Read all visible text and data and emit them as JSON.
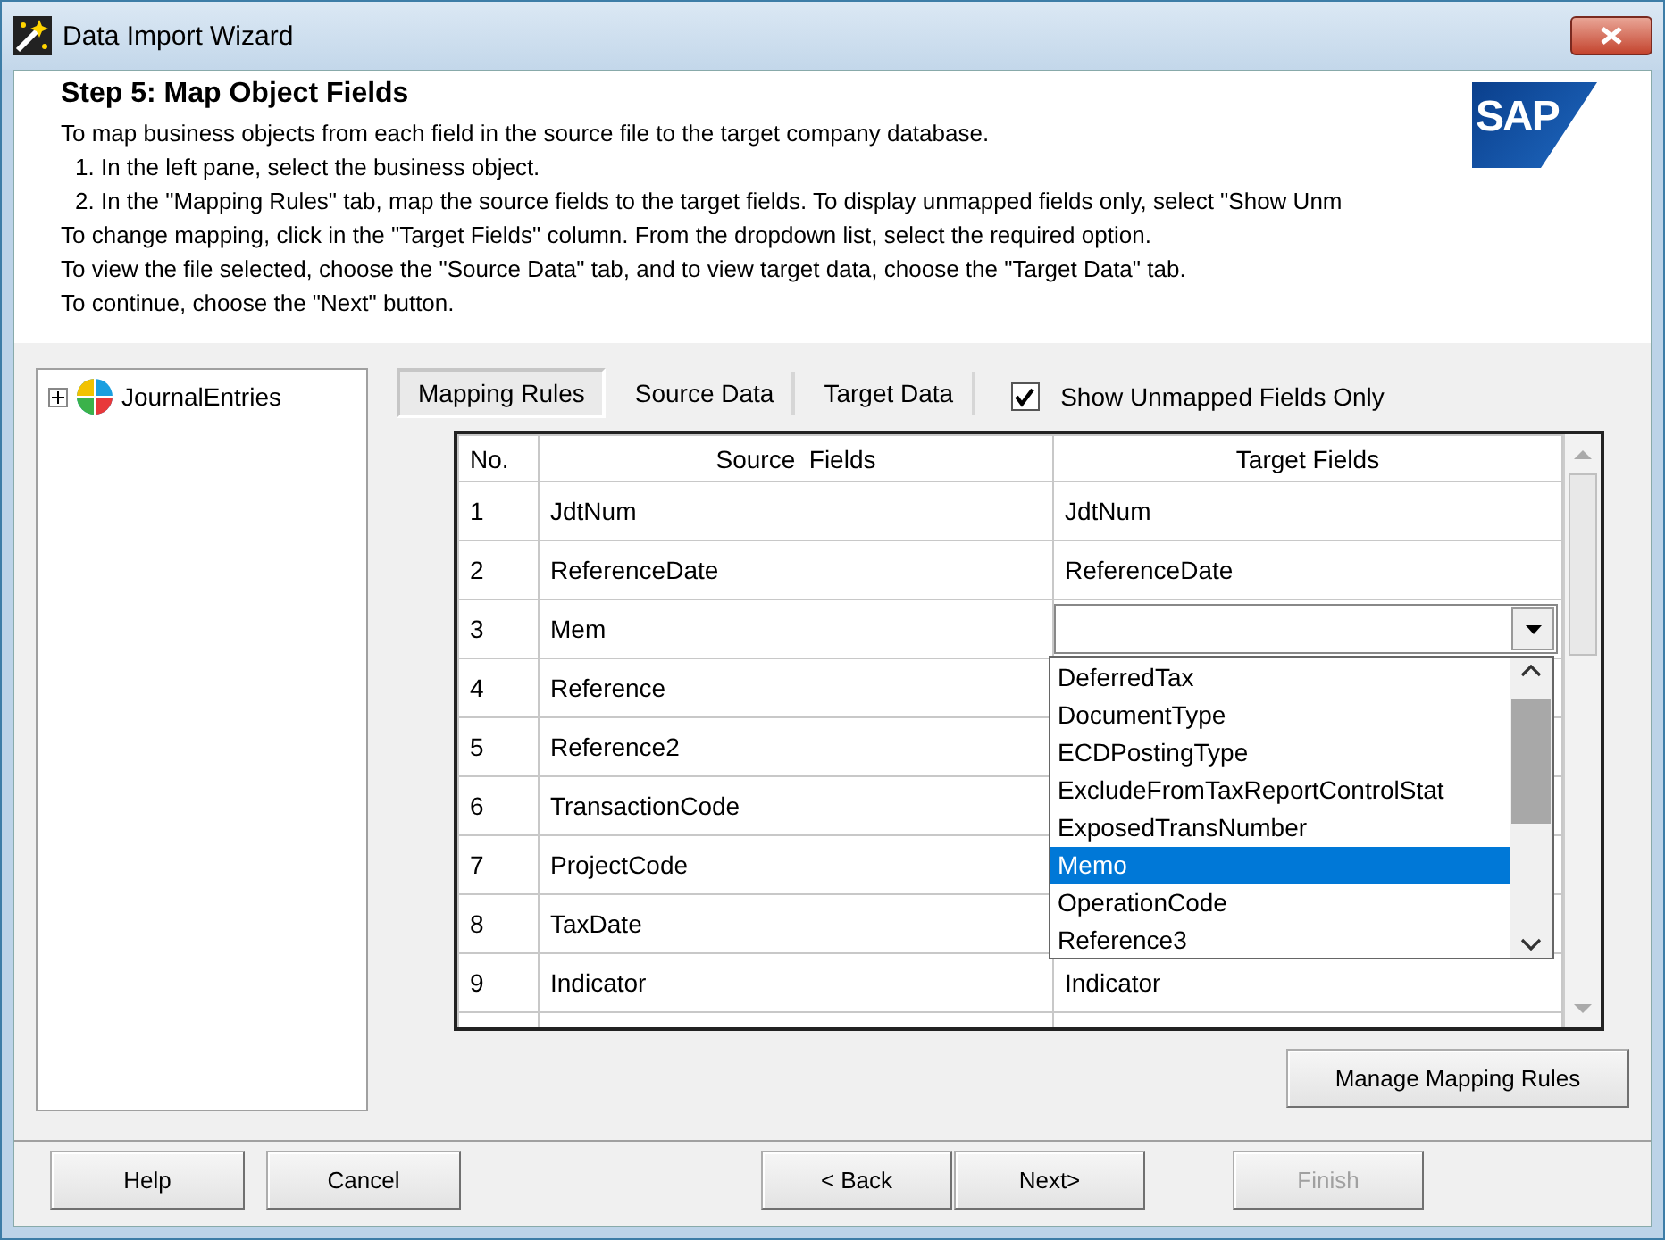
{
  "window": {
    "title": "Data Import Wizard"
  },
  "header": {
    "step_title": "Step 5: Map Object Fields",
    "logo": "SAP",
    "intro": "To map business objects from each field in the source file to the target company database.",
    "steps": [
      "1. In the left pane, select the business object.",
      "2. In the \"Mapping Rules\" tab, map the source fields to the target fields. To display unmapped fields only, select \"Show Unm"
    ],
    "notes": [
      "To change mapping, click in the \"Target Fields\" column. From the dropdown list, select the required option.",
      "To view the file selected, choose the \"Source Data\" tab, and to view target data, choose the \"Target Data\" tab.",
      "To continue, choose the \"Next\" button."
    ]
  },
  "tree": {
    "items": [
      {
        "label": "JournalEntries",
        "expanded": false
      }
    ]
  },
  "tabs": [
    {
      "label": "Mapping Rules",
      "selected": true
    },
    {
      "label": "Source Data",
      "selected": false
    },
    {
      "label": "Target Data",
      "selected": false
    }
  ],
  "show_unmapped": {
    "label": "Show Unmapped Fields Only",
    "checked": true
  },
  "table": {
    "columns": [
      "No.",
      "Source  Fields",
      "Target Fields"
    ],
    "rows": [
      {
        "no": "1",
        "source": "JdtNum",
        "target": "JdtNum",
        "kind": "text"
      },
      {
        "no": "2",
        "source": "ReferenceDate",
        "target": "ReferenceDate",
        "kind": "text"
      },
      {
        "no": "3",
        "source": "Mem",
        "kind": "combo"
      },
      {
        "no": "4",
        "source": "Reference",
        "kind": "text"
      },
      {
        "no": "5",
        "source": "Reference2",
        "kind": "text"
      },
      {
        "no": "6",
        "source": "TransactionCode",
        "kind": "text"
      },
      {
        "no": "7",
        "source": "ProjectCode",
        "kind": "text"
      },
      {
        "no": "8",
        "source": "TaxDate",
        "kind": "text"
      },
      {
        "no": "9",
        "source": "Indicator",
        "target": "Indicator",
        "kind": "text"
      }
    ],
    "dropdown": {
      "options": [
        {
          "label": "DeferredTax",
          "selected": false
        },
        {
          "label": "DocumentType",
          "selected": false
        },
        {
          "label": "ECDPostingType",
          "selected": false
        },
        {
          "label": "ExcludeFromTaxReportControlStat",
          "selected": false
        },
        {
          "label": "ExposedTransNumber",
          "selected": false
        },
        {
          "label": "Memo",
          "selected": true
        },
        {
          "label": "OperationCode",
          "selected": false
        },
        {
          "label": "Reference3",
          "selected": false
        }
      ]
    }
  },
  "manage_button": {
    "label": "Manage Mapping Rules"
  },
  "buttons": [
    {
      "label": "Help",
      "disabled": false
    },
    {
      "label": "Cancel",
      "disabled": false
    },
    {
      "label": "< Back",
      "disabled": false
    },
    {
      "label": "Next>",
      "disabled": false
    },
    {
      "label": "Finish",
      "disabled": true
    }
  ]
}
